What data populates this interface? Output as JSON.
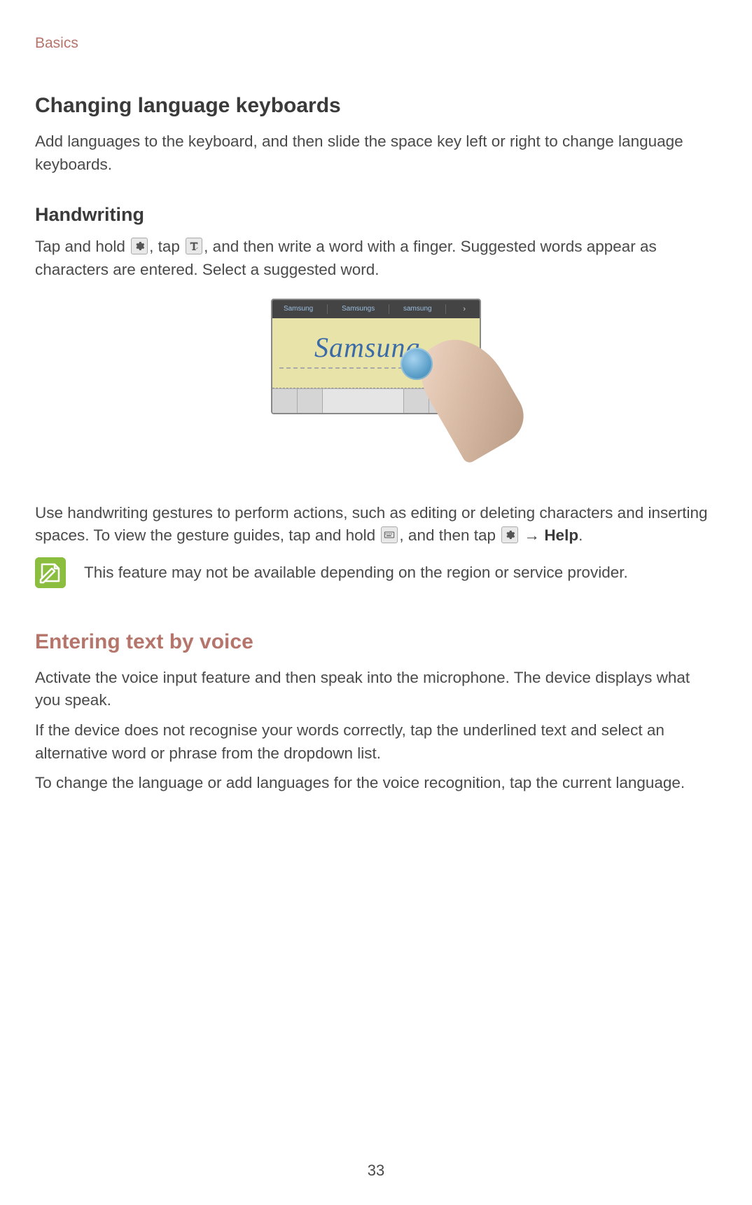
{
  "header": {
    "section": "Basics"
  },
  "section1": {
    "title": "Changing language keyboards",
    "body": "Add languages to the keyboard, and then slide the space key left or right to change language keyboards."
  },
  "section2": {
    "title": "Handwriting",
    "p1_a": "Tap and hold ",
    "p1_b": ", tap ",
    "p1_c": ", and then write a word with a finger. Suggested words appear as characters are entered. Select a suggested word.",
    "fig_suggestions": [
      "Samsung",
      "Samsungs",
      "samsung"
    ],
    "fig_handwriting": "Samsung",
    "p2_a": "Use handwriting gestures to perform actions, such as editing or deleting characters and inserting spaces. To view the gesture guides, tap and hold ",
    "p2_b": ", and then tap ",
    "p2_c": " → ",
    "p2_help": "Help",
    "p2_d": ".",
    "note": "This feature may not be available depending on the region or service provider."
  },
  "section3": {
    "title": "Entering text by voice",
    "p1": "Activate the voice input feature and then speak into the microphone. The device displays what you speak.",
    "p2": "If the device does not recognise your words correctly, tap the underlined text and select an alternative word or phrase from the dropdown list.",
    "p3": "To change the language or add languages for the voice recognition, tap the current language."
  },
  "page_number": "33"
}
